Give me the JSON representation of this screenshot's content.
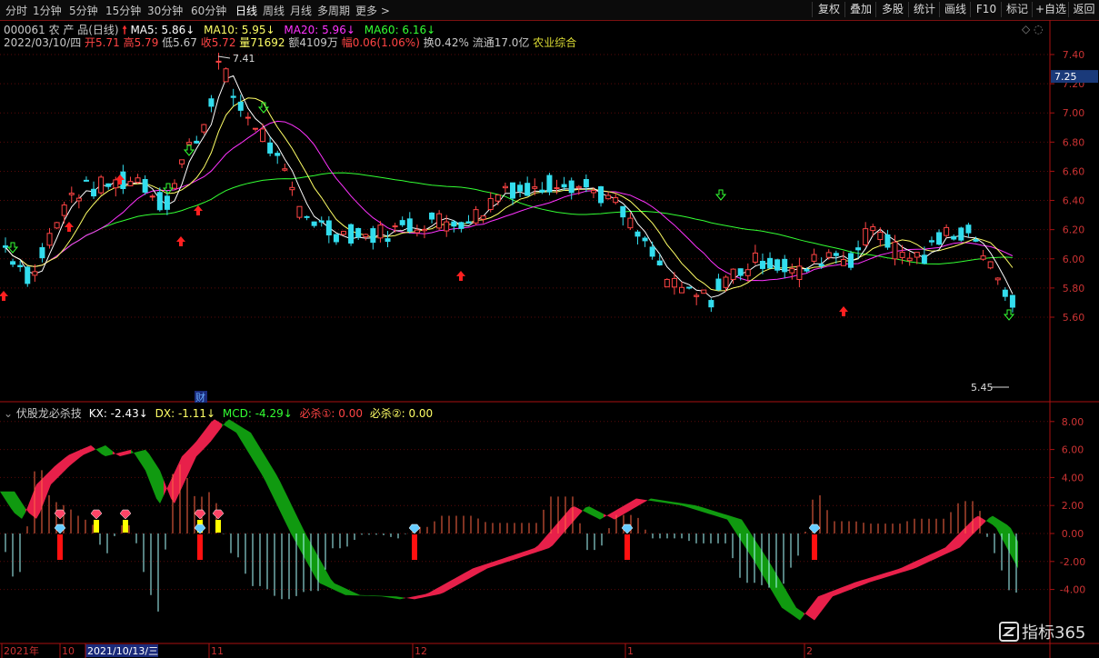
{
  "toolbar": {
    "periods": [
      "分时",
      "1分钟",
      "5分钟",
      "15分钟",
      "30分钟",
      "60分钟",
      "日线",
      "周线",
      "月线",
      "多周期",
      "更多 >"
    ],
    "active": "日线",
    "right_buttons": [
      "复权",
      "叠加",
      "多股",
      "统计",
      "画线",
      "F10",
      "标记",
      "+自选",
      "返回"
    ]
  },
  "stock": {
    "code_name": "000061 农 产 品(日线)",
    "ma": [
      {
        "label": "MA5: 5.86",
        "color": "#ffffff",
        "arrow": "↓"
      },
      {
        "label": "MA10: 5.95",
        "color": "#ffff66",
        "arrow": "↓"
      },
      {
        "label": "MA20: 5.96",
        "color": "#ff33ff",
        "arrow": "↓"
      },
      {
        "label": "MA60: 6.16",
        "color": "#33ff33",
        "arrow": "↓"
      }
    ],
    "date": "2022/03/10/四",
    "open": "开5.71",
    "high": "高5.79",
    "low": "低5.67",
    "close": "收5.72",
    "volume": "量71692",
    "amount": "额4109万",
    "change": "幅0.06(1.06%)",
    "turnover": "换0.42%",
    "float_cap": "流通17.0亿",
    "sector": "农业综合"
  },
  "price_axis": {
    "ticks": [
      "7.40",
      "7.20",
      "7.00",
      "6.80",
      "6.60",
      "6.40",
      "6.20",
      "6.00",
      "5.80",
      "5.60"
    ],
    "tick_values": [
      7.4,
      7.2,
      7.0,
      6.8,
      6.6,
      6.4,
      6.2,
      6.0,
      5.8,
      5.6
    ],
    "current": "7.25",
    "high_label": "7.41",
    "low_label": "5.45",
    "colors": {
      "up": "#ff4444",
      "down": "#33ddee",
      "ma5": "#ffffff",
      "ma10": "#ffff66",
      "ma20": "#ff33ff",
      "ma60": "#33ff33"
    }
  },
  "indicator": {
    "title": "伏股龙必杀技",
    "kx": "KX: -2.43",
    "dx": "DX: -1.11",
    "mcd": "MCD: -4.29",
    "bisha1": "必杀①: 0.00",
    "bisha2": "必杀②: 0.00",
    "ticks": [
      "8.00",
      "6.00",
      "4.00",
      "2.00",
      "0.00",
      "-2.00",
      "-4.00"
    ],
    "tick_values": [
      8,
      6,
      4,
      2,
      0,
      -2,
      -4
    ],
    "colors": {
      "bull": "#e8204a",
      "bear": "#109a10",
      "bar_up": "#ff6644",
      "bar_down": "#aaffff"
    }
  },
  "time_axis": {
    "labels": [
      "2021年",
      "10",
      "2021/10/13/三",
      "11",
      "12",
      "1",
      "2"
    ],
    "event": "财"
  },
  "brand": "指标365"
}
